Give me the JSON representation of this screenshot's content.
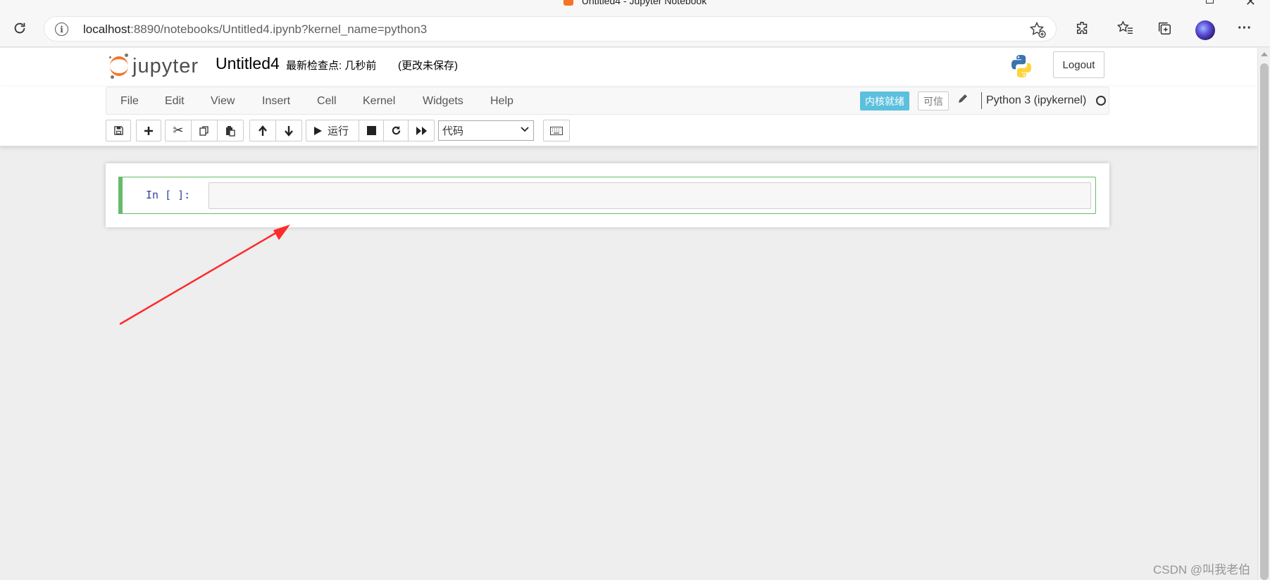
{
  "window": {
    "title": "Untitled4 - Jupyter Notebook"
  },
  "browser": {
    "url_host": "localhost",
    "url_rest": ":8890/notebooks/Untitled4.ipynb?kernel_name=python3"
  },
  "header": {
    "logo_text": "jupyter",
    "notebook_name": "Untitled4",
    "checkpoint_label": "最新检查点: 几秒前",
    "autosave_status": "(更改未保存)",
    "logout_label": "Logout"
  },
  "menu": {
    "items": [
      "File",
      "Edit",
      "View",
      "Insert",
      "Cell",
      "Kernel",
      "Widgets",
      "Help"
    ],
    "kernel_status": "内核就绪",
    "trusted_label": "可信",
    "kernel_name": "Python 3 (ipykernel)"
  },
  "toolbar": {
    "run_label": "运行",
    "cell_type": "代码"
  },
  "cell": {
    "prompt": "In [ ]:",
    "input": ""
  },
  "watermark": "CSDN @叫我老伯",
  "colors": {
    "accent_orange": "#f37626",
    "kernel_badge": "#5bc0de",
    "cell_border_edit": "#66bb6a",
    "annotation_arrow": "#ff2a2a"
  }
}
